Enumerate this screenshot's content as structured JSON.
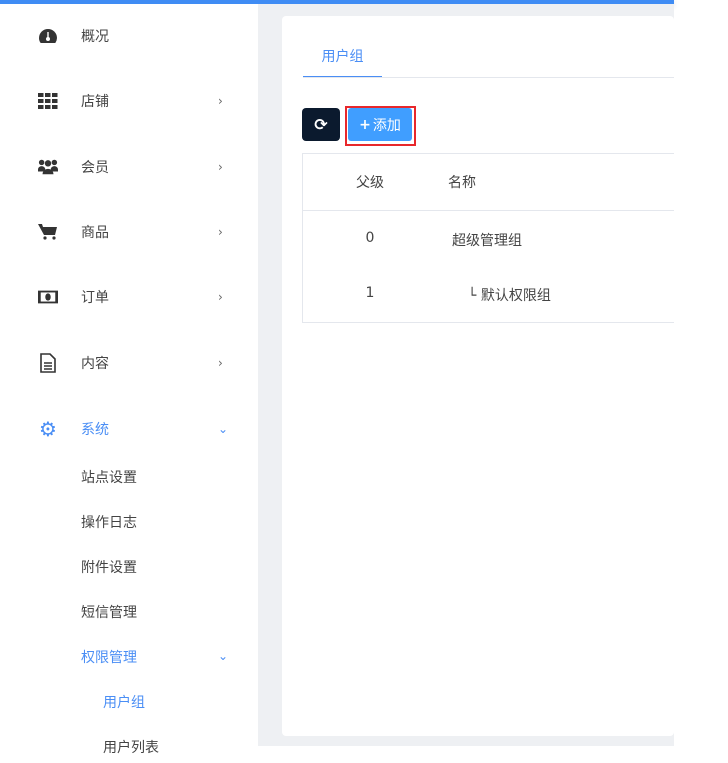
{
  "sidebar": {
    "items": [
      {
        "label": "概况",
        "icon": "dashboard-icon"
      },
      {
        "label": "店铺",
        "icon": "grid-icon"
      },
      {
        "label": "会员",
        "icon": "users-icon"
      },
      {
        "label": "商品",
        "icon": "cart-icon"
      },
      {
        "label": "订单",
        "icon": "money-icon"
      },
      {
        "label": "内容",
        "icon": "document-icon"
      },
      {
        "label": "系统",
        "icon": "gear-icon"
      }
    ],
    "system_sub": [
      "站点设置",
      "操作日志",
      "附件设置",
      "短信管理",
      "权限管理"
    ],
    "permission_sub": [
      "用户组",
      "用户列表"
    ]
  },
  "main": {
    "tab": "用户组",
    "add_label": "添加",
    "columns": [
      "父级",
      "名称"
    ],
    "rows": [
      {
        "parent": "0",
        "name": "超级管理组"
      },
      {
        "parent": "1",
        "name": "└ 默认权限组"
      }
    ]
  },
  "colors": {
    "accent": "#409eff",
    "dark": "#0b1a2e",
    "highlight": "#e8272b"
  }
}
